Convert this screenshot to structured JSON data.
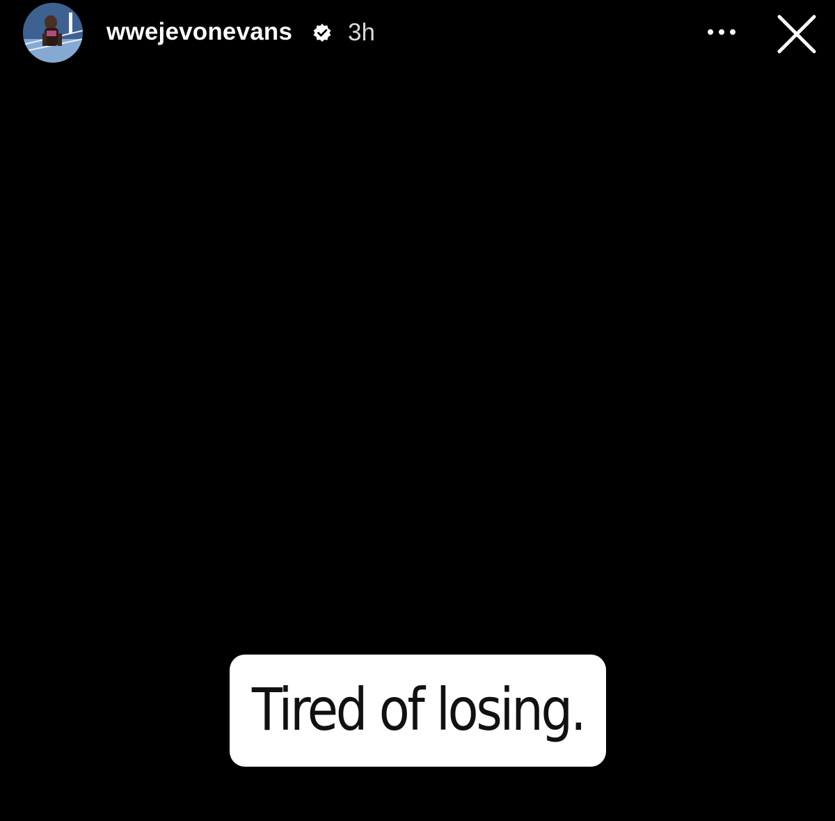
{
  "header": {
    "username": "wwejevonevans",
    "timestamp": "3h",
    "avatar_icon": "profile-photo-wrestler",
    "verified_icon": "verified-badge-icon",
    "more_icon": "more-options-icon",
    "close_icon": "close-icon"
  },
  "story": {
    "background_color": "#000000",
    "caption": "Tired of losing."
  }
}
